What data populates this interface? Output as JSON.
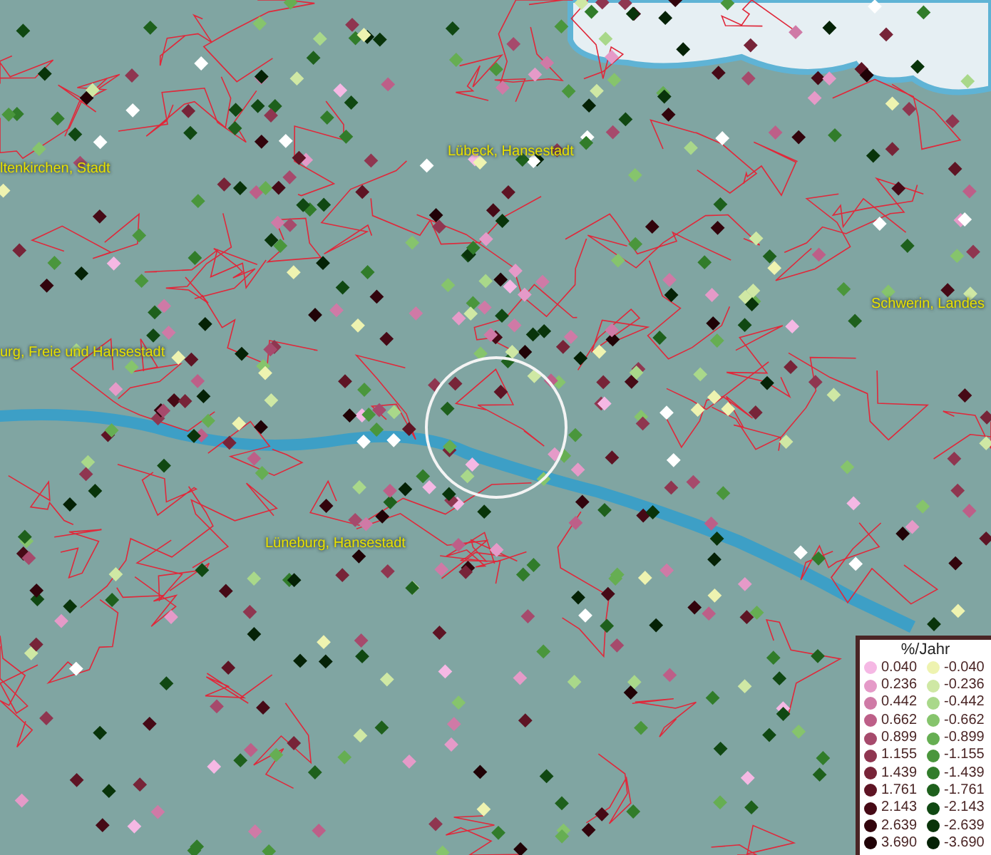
{
  "map": {
    "labels": [
      {
        "text": "ltenkirchen, Stadt"
      },
      {
        "text": "Lübeck, Hansestadt"
      },
      {
        "text": "urg, Freie und Hansestadt"
      },
      {
        "text": "Schwerin, Landes"
      },
      {
        "text": "Lüneburg, Hansestadt"
      }
    ]
  },
  "legend": {
    "title": "%/Jahr",
    "columns": [
      {
        "items": [
          {
            "label": "0.040",
            "color": "#f5b8e4"
          },
          {
            "label": "0.236",
            "color": "#e59ac8"
          },
          {
            "label": "0.442",
            "color": "#cf7aa6"
          },
          {
            "label": "0.662",
            "color": "#bd5f88"
          },
          {
            "label": "0.899",
            "color": "#a64a6c"
          },
          {
            "label": "1.155",
            "color": "#8f3650"
          },
          {
            "label": "1.439",
            "color": "#772438"
          },
          {
            "label": "1.761",
            "color": "#5e1424"
          },
          {
            "label": "2.143",
            "color": "#460a16"
          },
          {
            "label": "2.639",
            "color": "#32040c"
          },
          {
            "label": "3.690",
            "color": "#200206"
          }
        ]
      },
      {
        "items": [
          {
            "label": "-0.040",
            "color": "#eef3b0"
          },
          {
            "label": "-0.236",
            "color": "#cfe8a4"
          },
          {
            "label": "-0.442",
            "color": "#a9d88a"
          },
          {
            "label": "-0.662",
            "color": "#86c46c"
          },
          {
            "label": "-0.899",
            "color": "#66ae52"
          },
          {
            "label": "-1.155",
            "color": "#4a963c"
          },
          {
            "label": "-1.439",
            "color": "#317c2a"
          },
          {
            "label": "-1.761",
            "color": "#1e601c"
          },
          {
            "label": "-2.143",
            "color": "#104812"
          },
          {
            "label": "-2.639",
            "color": "#09340a"
          },
          {
            "label": "-3.690",
            "color": "#052206"
          }
        ]
      }
    ]
  }
}
